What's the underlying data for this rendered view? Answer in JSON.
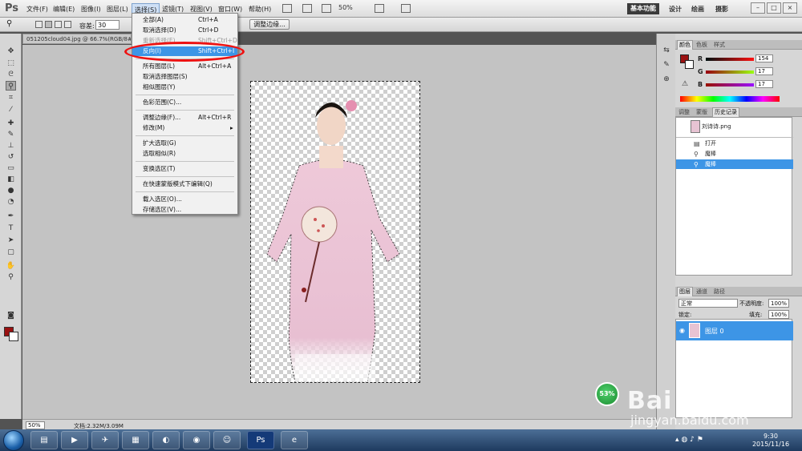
{
  "app": {
    "logo": "Ps"
  },
  "menubar": {
    "items": [
      "文件(F)",
      "编辑(E)",
      "图像(I)",
      "图层(L)",
      "选择(S)",
      "滤镜(T)",
      "视图(V)",
      "窗口(W)",
      "帮助(H)"
    ],
    "zoom": "50%",
    "workspace_active": "基本功能",
    "workspace_links": [
      "设计",
      "绘画",
      "摄影"
    ],
    "window_buttons": [
      "–",
      "□",
      "×"
    ]
  },
  "optbar": {
    "tolerance_label": "容差:",
    "tolerance_value": "30",
    "refine_edge": "调整边缘..."
  },
  "document": {
    "tab_title": "051205cloud04.jpg @ 66.7%(RGB/8#)"
  },
  "select_menu": {
    "items": [
      {
        "label": "全部(A)",
        "shortcut": "Ctrl+A"
      },
      {
        "label": "取消选择(D)",
        "shortcut": "Ctrl+D"
      },
      {
        "label": "重新选择(E)",
        "shortcut": "Shift+Ctrl+D"
      },
      {
        "label": "反向(I)",
        "shortcut": "Shift+Ctrl+I"
      },
      {
        "label": "所有图层(L)",
        "shortcut": "Alt+Ctrl+A"
      },
      {
        "label": "取消选择图层(S)",
        "shortcut": ""
      },
      {
        "label": "相似图层(Y)",
        "shortcut": ""
      },
      {
        "label": "色彩范围(C)...",
        "shortcut": ""
      },
      {
        "label": "调整边缘(F)...",
        "shortcut": "Alt+Ctrl+R"
      },
      {
        "label": "修改(M)",
        "shortcut": "▸"
      },
      {
        "label": "扩大选取(G)",
        "shortcut": ""
      },
      {
        "label": "选取相似(R)",
        "shortcut": ""
      },
      {
        "label": "变换选区(T)",
        "shortcut": ""
      },
      {
        "label": "在快速蒙版模式下编辑(Q)",
        "shortcut": ""
      },
      {
        "label": "载入选区(O)...",
        "shortcut": ""
      },
      {
        "label": "存储选区(V)...",
        "shortcut": ""
      }
    ]
  },
  "statusbar": {
    "zoom": "50%",
    "doc_size": "文档:2.32M/3.09M"
  },
  "color_panel": {
    "tabs": [
      "颜色",
      "色板",
      "样式"
    ],
    "r_label": "R",
    "g_label": "G",
    "b_label": "B",
    "r": "154",
    "g": "17",
    "b": "17",
    "fg_hex": "#9a1111"
  },
  "history_panel": {
    "tabs": [
      "调整",
      "蒙版",
      "历史记录"
    ],
    "snapshot": "刘诗诗.png",
    "steps": [
      "打开",
      "魔棒",
      "魔棒"
    ]
  },
  "layers_panel": {
    "tabs": [
      "图层",
      "通道",
      "路径"
    ],
    "blend_mode": "正常",
    "opacity_label": "不透明度:",
    "opacity": "100%",
    "lock_label": "锁定:",
    "fill_label": "填充:",
    "fill": "100%",
    "layer_name": "图层 0"
  },
  "taskbar": {
    "time": "9:30",
    "date": "2015/11/16",
    "ps_label": "Ps"
  },
  "watermark": {
    "badge": "53%",
    "brand": "Bai du 经验",
    "url": "jingyan.baidu.com"
  }
}
